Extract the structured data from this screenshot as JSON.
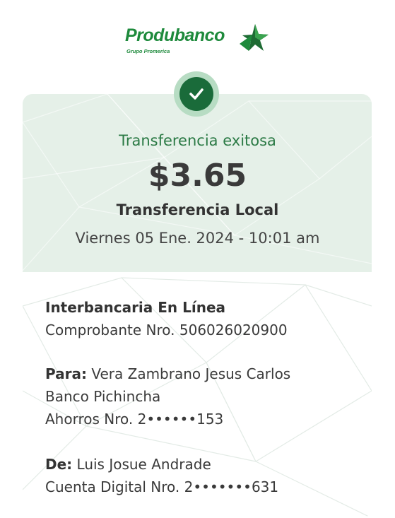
{
  "header": {
    "logo_text": "Produbanco",
    "logo_subtext": "Grupo Promerica"
  },
  "receipt": {
    "status": "Transferencia exitosa",
    "amount": "$3.65",
    "type": "Transferencia Local",
    "datetime": "Viernes 05 Ene. 2024 - 10:01 am"
  },
  "details": {
    "channel": "Interbancaria En Línea",
    "voucher": "Comprobante Nro. 506026020900",
    "to_label": "Para:",
    "to_name": " Vera Zambrano Jesus Carlos",
    "to_bank": "Banco Pichincha",
    "to_account": "Ahorros Nro. 2••••••153",
    "from_label": "De:",
    "from_name": " Luis Josue Andrade",
    "from_account": "Cuenta Digital Nro. 2•••••••631"
  },
  "colors": {
    "brand_green": "#1e8a3c",
    "status_green": "#2b7a45",
    "header_bg": "#e5f0e8",
    "check_bg": "#1a6b3a"
  },
  "icons": {
    "logo_star": "star-logo-icon",
    "success": "check-icon"
  }
}
